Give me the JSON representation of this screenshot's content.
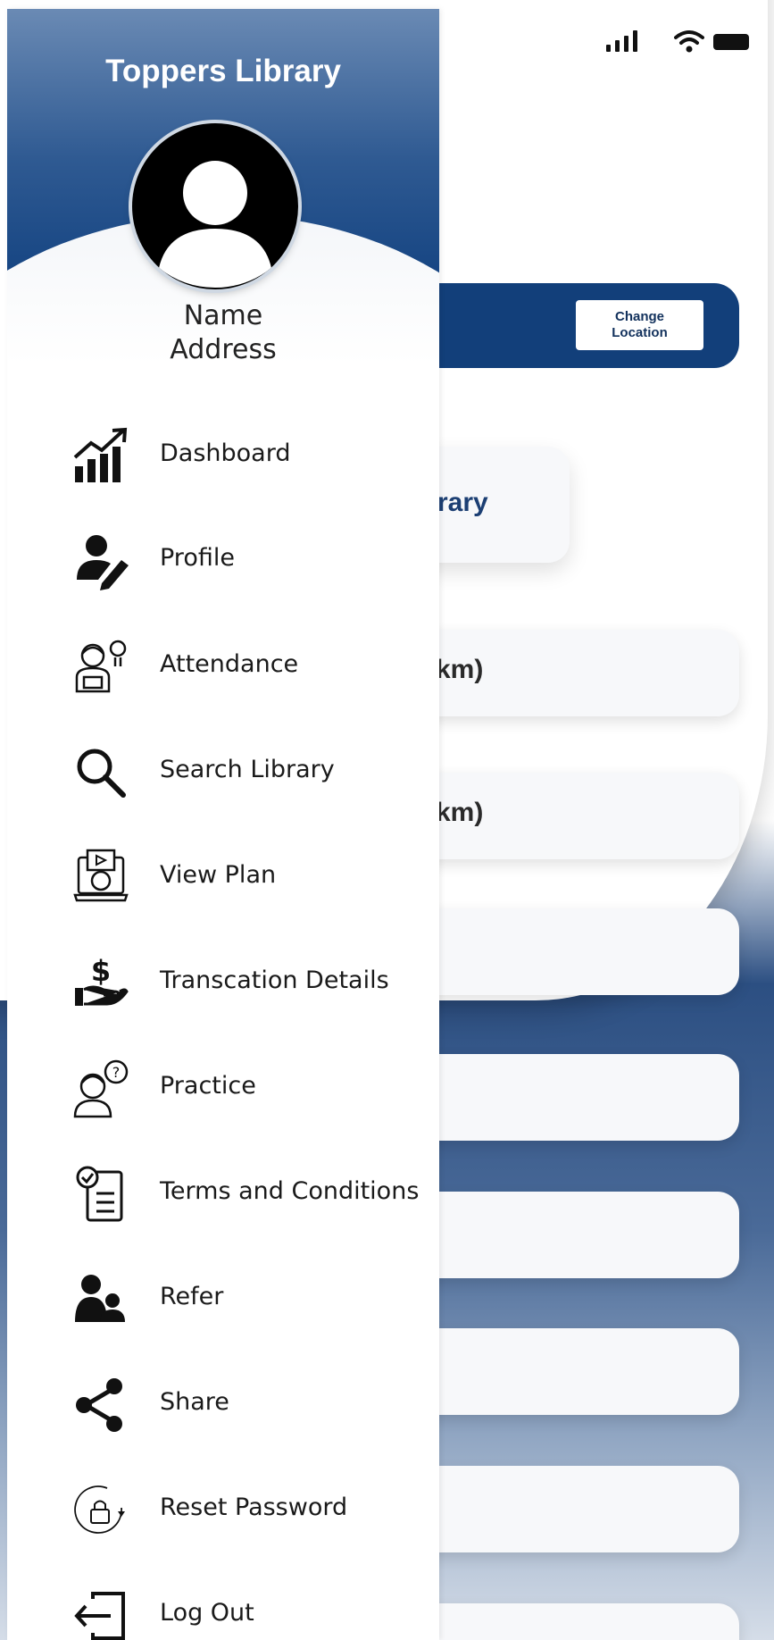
{
  "app_title": "Toppers Library",
  "user": {
    "name": "Name",
    "address": "Address"
  },
  "background": {
    "change_location_label": "Change\nLocation",
    "library_card_text": "rary",
    "list_items": [
      "km)",
      "km)",
      "",
      "",
      "",
      "",
      "",
      ""
    ]
  },
  "menu": [
    {
      "label": "Dashboard",
      "icon": "dashboard-chart-icon"
    },
    {
      "label": "Profile",
      "icon": "profile-edit-icon"
    },
    {
      "label": "Attendance",
      "icon": "attendance-student-icon"
    },
    {
      "label": "Search Library",
      "icon": "search-icon"
    },
    {
      "label": "View Plan",
      "icon": "view-plan-video-icon"
    },
    {
      "label": "Transcation Details",
      "icon": "transaction-dollar-hand-icon"
    },
    {
      "label": "Practice",
      "icon": "practice-question-icon"
    },
    {
      "label": "Terms and Conditions",
      "icon": "terms-checklist-icon"
    },
    {
      "label": "Refer",
      "icon": "refer-users-icon"
    },
    {
      "label": "Share",
      "icon": "share-icon"
    },
    {
      "label": "Reset Password",
      "icon": "reset-password-lock-icon"
    },
    {
      "label": "Log Out",
      "icon": "log-out-icon"
    }
  ],
  "colors": {
    "primary": "#0f3f7e",
    "header_top": "#6a8ab4",
    "text": "#1a1a1a"
  }
}
